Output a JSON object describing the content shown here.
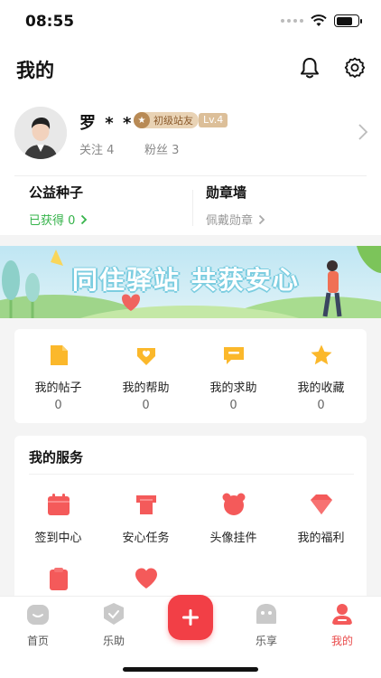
{
  "status_bar": {
    "time": "08:55"
  },
  "header": {
    "title": "我的"
  },
  "profile": {
    "name": "罗 * *",
    "level_badge": "初级站友",
    "level_tag": "Lv.4",
    "following": "关注 4",
    "fans": "粉丝 3"
  },
  "cards": {
    "seeds": {
      "title": "公益种子",
      "sub": "已获得 0"
    },
    "medals": {
      "title": "勋章墙",
      "sub": "佩戴勋章"
    }
  },
  "banner": {
    "text": "同住驿站 共获安心"
  },
  "stats": [
    {
      "label": "我的帖子",
      "value": "0",
      "icon": "doc-icon"
    },
    {
      "label": "我的帮助",
      "value": "0",
      "icon": "heart-hand-icon"
    },
    {
      "label": "我的求助",
      "value": "0",
      "icon": "chat-icon"
    },
    {
      "label": "我的收藏",
      "value": "0",
      "icon": "star-icon"
    }
  ],
  "services": {
    "title": "我的服务",
    "items": [
      {
        "label": "签到中心",
        "icon": "calendar-icon"
      },
      {
        "label": "安心任务",
        "icon": "shirt-icon"
      },
      {
        "label": "头像挂件",
        "icon": "bear-icon"
      },
      {
        "label": "我的福利",
        "icon": "diamond-icon"
      }
    ]
  },
  "tabbar": {
    "items": [
      {
        "label": "首页"
      },
      {
        "label": "乐助"
      },
      {
        "label": "乐享"
      },
      {
        "label": "我的"
      }
    ]
  },
  "colors": {
    "accent": "#f23f46",
    "green": "#35b34a",
    "orange": "#fbb82b",
    "red": "#f45a5a"
  }
}
